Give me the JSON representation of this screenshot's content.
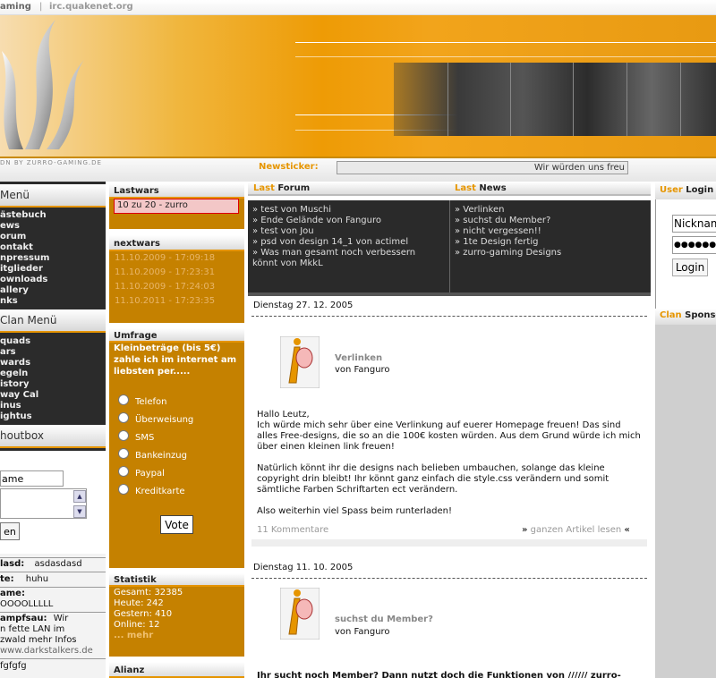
{
  "topbar": {
    "site": "aming",
    "irc": "irc.quakenet.org"
  },
  "banner": {
    "byline": "DN BY ZURRO-GAMING.DE"
  },
  "newsticker": {
    "label": "Newsticker:",
    "text": "Wir würden uns freu"
  },
  "left_menu": {
    "title": "Menü",
    "items": [
      "ästebuch",
      "ews",
      "orum",
      "ontakt",
      "npressum",
      "itglieder",
      "ownloads",
      "allery",
      "nks"
    ]
  },
  "clan_menu": {
    "title": "Clan Menü",
    "items": [
      "quads",
      "ars",
      "wards",
      "egeln",
      "istory",
      "way Cal",
      "inus",
      "ightus"
    ]
  },
  "shoutbox": {
    "title": "houtbox",
    "name_value": "ame",
    "send_label": "en",
    "entries": [
      {
        "author": "lasd:",
        "text": "asdasdasd"
      },
      {
        "author": "te:",
        "text": "huhu"
      },
      {
        "author": "ame:",
        "text": "OOOOLLLLL"
      },
      {
        "author": "ampfsau:",
        "text": "Wir"
      },
      {
        "author": "",
        "text": "n fette LAN im"
      },
      {
        "author": "",
        "text": "zwald mehr Infos"
      },
      {
        "author": "",
        "text": "www.darkstalkers.de"
      },
      {
        "author": "",
        "text": "fgfgfg"
      }
    ]
  },
  "lastwars": {
    "title": "Lastwars",
    "entry": "10 zu 20 - zurro"
  },
  "nextwars": {
    "title": "nextwars",
    "entries": [
      "11.10.2009 - 17:09:18",
      "11.10.2009 - 17:23:31",
      "11.10.2009 - 17:24:03",
      "11.10.2011 - 17:23:35"
    ]
  },
  "umfrage": {
    "title": "Umfrage",
    "question": "Kleinbeträge (bis 5€) zahle ich im internet am liebsten per.....",
    "options": [
      "Telefon",
      "Überweisung",
      "SMS",
      "Bankeinzug",
      "Paypal",
      "Kreditkarte"
    ],
    "vote_label": "Vote"
  },
  "statistik": {
    "title": "Statistik",
    "gesamt": "Gesamt: 32385",
    "heute": "Heute: 242",
    "gestern": "Gestern: 410",
    "online": "Online: 12",
    "more": "... mehr"
  },
  "allianz": {
    "title": "Alianz"
  },
  "last_forum": {
    "prefix": "Last",
    "title": "Forum",
    "items": [
      "test von Muschi",
      "Ende Gelände von Fanguro",
      "test von Jou",
      "psd von design 14_1 von actimel",
      "Was man gesamt noch verbessern",
      "könnt von MkkL"
    ]
  },
  "last_news": {
    "prefix": "Last",
    "title": "News",
    "items": [
      "Verlinken",
      "suchst du Member?",
      "nicht vergessen!!",
      "1te Design fertig",
      "zurro-gaming Designs"
    ]
  },
  "articles": [
    {
      "date": "Dienstag 27. 12. 2005",
      "title": "Verlinken",
      "author": "von Fanguro",
      "body": [
        "Hallo Leutz,",
        "Ich würde mich sehr über eine Verlinkung auf euerer Homepage freuen! Das sind alles Free-designs, die so an die 100€ kosten würden. Aus dem Grund würde ich mich über einen kleinen link freuen!",
        "Natürlich könnt ihr die designs nach belieben umbauchen, solange das kleine copyright drin bleibt! Ihr könnt ganz einfach die style.css verändern und somit sämtliche Farben Schriftarten ect verändern.",
        "Also weiterhin viel Spass beim runterladen!"
      ],
      "comments": "11 Kommentare",
      "readmore": "ganzen Artikel lesen"
    },
    {
      "date": "Dienstag 11. 10. 2005",
      "title": "suchst du Member?",
      "author": "von Fanguro",
      "body": [
        "Ihr sucht noch Member? Dann nutzt doch die Funktionen von ////// zurro-"
      ]
    }
  ],
  "user_login": {
    "prefix": "User",
    "title": "Login",
    "nick_value": "Nicknam",
    "password_value": "●●●●●●●●",
    "login_label": "Login"
  },
  "clan_sponsor": {
    "prefix": "Clan",
    "title": "Sponso"
  },
  "colors": {
    "accent": "#e69500",
    "dark": "#2b2b2b",
    "panel": "#c58100"
  }
}
